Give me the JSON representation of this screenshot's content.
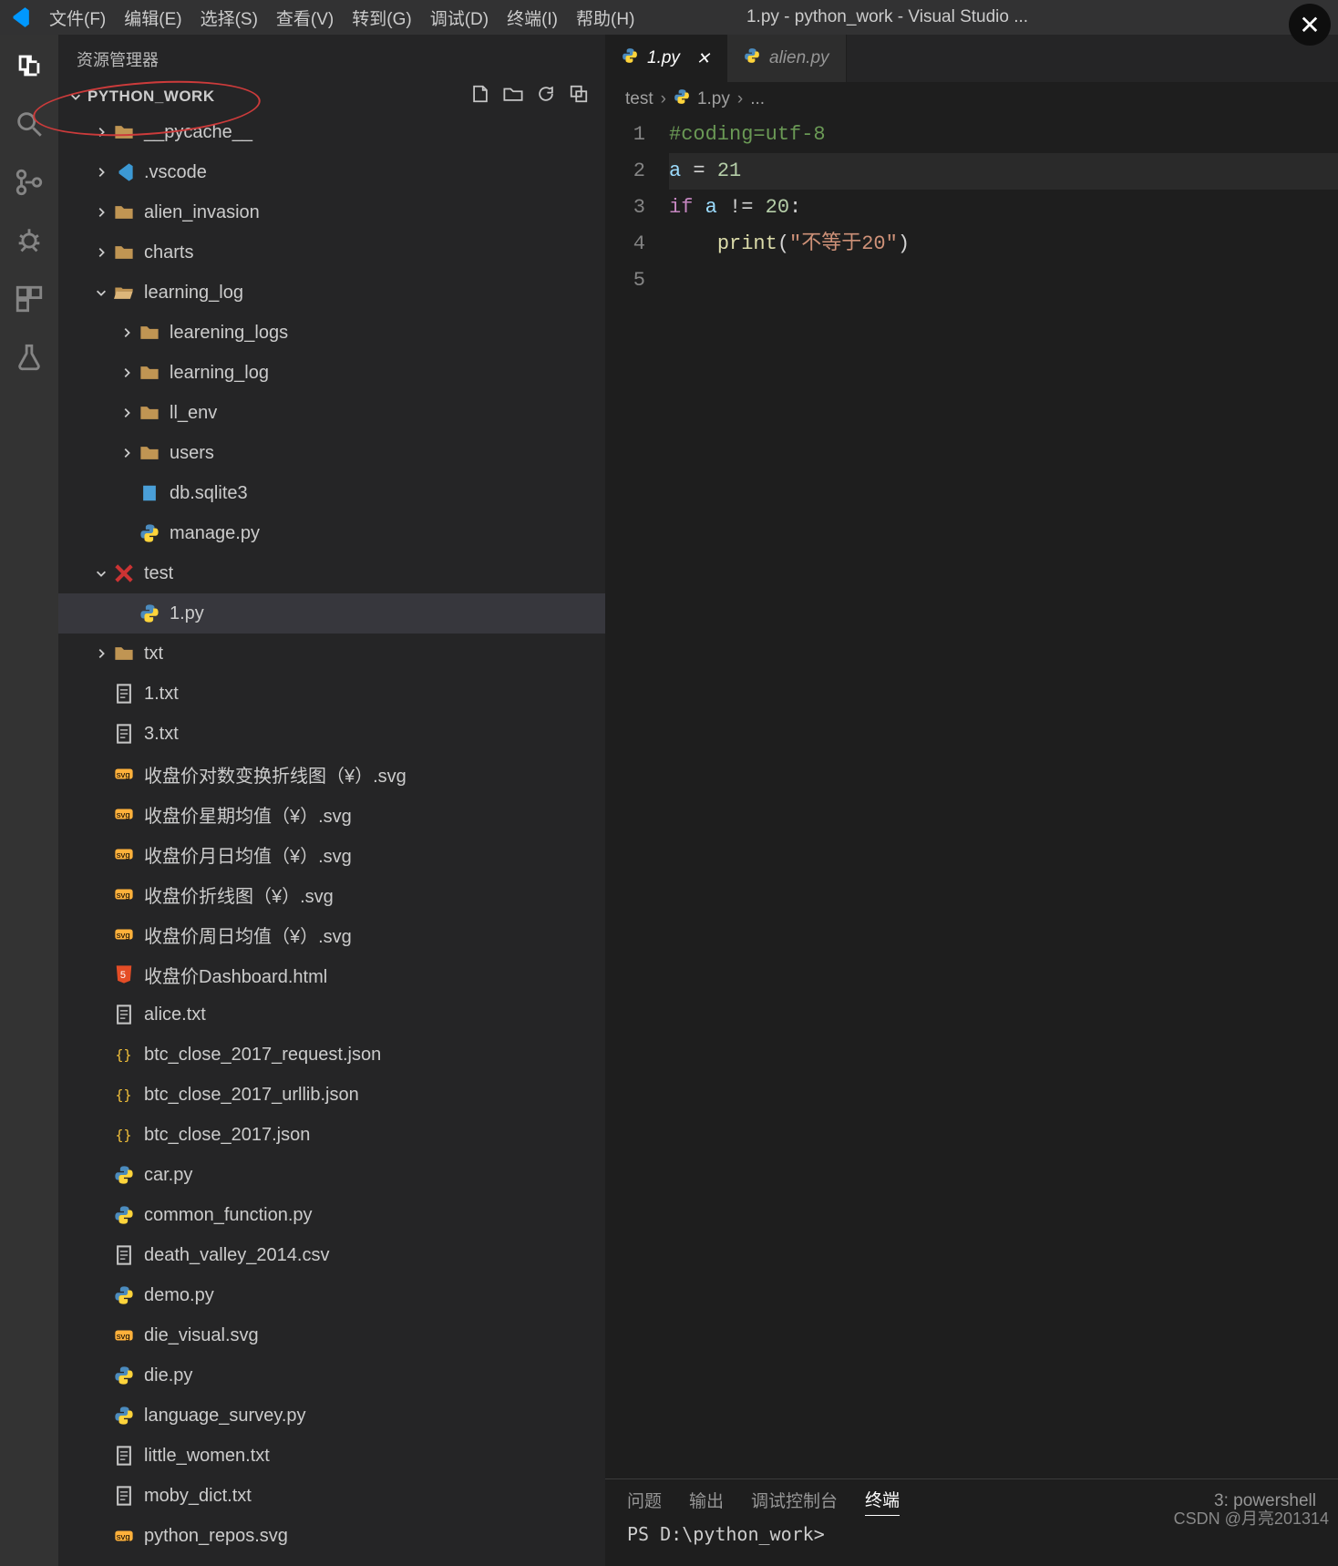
{
  "window_title": "1.py - python_work - Visual Studio ...",
  "menu": [
    "文件(F)",
    "编辑(E)",
    "选择(S)",
    "查看(V)",
    "转到(G)",
    "调试(D)",
    "终端(I)",
    "帮助(H)"
  ],
  "sidebar": {
    "title": "资源管理器",
    "root": "PYTHON_WORK",
    "tree": [
      {
        "depth": 1,
        "chev": "right",
        "icon": "folder",
        "label": "__pycache__"
      },
      {
        "depth": 1,
        "chev": "right",
        "icon": "vscode",
        "label": ".vscode"
      },
      {
        "depth": 1,
        "chev": "right",
        "icon": "folder",
        "label": "alien_invasion"
      },
      {
        "depth": 1,
        "chev": "right",
        "icon": "folder",
        "label": "charts"
      },
      {
        "depth": 1,
        "chev": "down",
        "icon": "folder-open",
        "label": "learning_log"
      },
      {
        "depth": 2,
        "chev": "right",
        "icon": "folder",
        "label": "learening_logs"
      },
      {
        "depth": 2,
        "chev": "right",
        "icon": "folder",
        "label": "learning_log"
      },
      {
        "depth": 2,
        "chev": "right",
        "icon": "folder",
        "label": "ll_env"
      },
      {
        "depth": 2,
        "chev": "right",
        "icon": "folder",
        "label": "users"
      },
      {
        "depth": 2,
        "chev": "none",
        "icon": "db",
        "label": "db.sqlite3"
      },
      {
        "depth": 2,
        "chev": "none",
        "icon": "python",
        "label": "manage.py"
      },
      {
        "depth": 1,
        "chev": "down",
        "icon": "test",
        "label": "test"
      },
      {
        "depth": 2,
        "chev": "none",
        "icon": "python",
        "label": "1.py",
        "selected": true
      },
      {
        "depth": 1,
        "chev": "right",
        "icon": "folder",
        "label": "txt"
      },
      {
        "depth": 1,
        "chev": "none",
        "icon": "text",
        "label": "1.txt"
      },
      {
        "depth": 1,
        "chev": "none",
        "icon": "text",
        "label": "3.txt"
      },
      {
        "depth": 1,
        "chev": "none",
        "icon": "svg",
        "label": "收盘价对数变换折线图（¥）.svg"
      },
      {
        "depth": 1,
        "chev": "none",
        "icon": "svg",
        "label": "收盘价星期均值（¥）.svg"
      },
      {
        "depth": 1,
        "chev": "none",
        "icon": "svg",
        "label": "收盘价月日均值（¥）.svg"
      },
      {
        "depth": 1,
        "chev": "none",
        "icon": "svg",
        "label": "收盘价折线图（¥）.svg"
      },
      {
        "depth": 1,
        "chev": "none",
        "icon": "svg",
        "label": "收盘价周日均值（¥）.svg"
      },
      {
        "depth": 1,
        "chev": "none",
        "icon": "html",
        "label": "收盘价Dashboard.html"
      },
      {
        "depth": 1,
        "chev": "none",
        "icon": "text",
        "label": "alice.txt"
      },
      {
        "depth": 1,
        "chev": "none",
        "icon": "json",
        "label": "btc_close_2017_request.json"
      },
      {
        "depth": 1,
        "chev": "none",
        "icon": "json",
        "label": "btc_close_2017_urllib.json"
      },
      {
        "depth": 1,
        "chev": "none",
        "icon": "json",
        "label": "btc_close_2017.json"
      },
      {
        "depth": 1,
        "chev": "none",
        "icon": "python",
        "label": "car.py"
      },
      {
        "depth": 1,
        "chev": "none",
        "icon": "python",
        "label": "common_function.py"
      },
      {
        "depth": 1,
        "chev": "none",
        "icon": "text",
        "label": "death_valley_2014.csv"
      },
      {
        "depth": 1,
        "chev": "none",
        "icon": "python",
        "label": "demo.py"
      },
      {
        "depth": 1,
        "chev": "none",
        "icon": "svg",
        "label": "die_visual.svg"
      },
      {
        "depth": 1,
        "chev": "none",
        "icon": "python",
        "label": "die.py"
      },
      {
        "depth": 1,
        "chev": "none",
        "icon": "python",
        "label": "language_survey.py"
      },
      {
        "depth": 1,
        "chev": "none",
        "icon": "text",
        "label": "little_women.txt"
      },
      {
        "depth": 1,
        "chev": "none",
        "icon": "text",
        "label": "moby_dict.txt"
      },
      {
        "depth": 1,
        "chev": "none",
        "icon": "svg",
        "label": "python_repos.svg"
      }
    ]
  },
  "tabs": [
    {
      "label": "1.py",
      "active": true,
      "close": true
    },
    {
      "label": "alien.py",
      "active": false,
      "close": false
    }
  ],
  "breadcrumb": {
    "parts": [
      "test",
      "1.py",
      "..."
    ]
  },
  "code": {
    "lines": [
      {
        "n": "1",
        "tokens": [
          {
            "t": "#coding=utf-8",
            "c": "comment"
          }
        ]
      },
      {
        "n": "2",
        "hl": true,
        "tokens": [
          {
            "t": "a",
            "c": "var"
          },
          {
            "t": " = ",
            "c": "op"
          },
          {
            "t": "21",
            "c": "num"
          }
        ]
      },
      {
        "n": "3",
        "tokens": [
          {
            "t": "if",
            "c": "kw"
          },
          {
            "t": " ",
            "c": "op"
          },
          {
            "t": "a",
            "c": "var"
          },
          {
            "t": " != ",
            "c": "op"
          },
          {
            "t": "20",
            "c": "num"
          },
          {
            "t": ":",
            "c": "punc"
          }
        ]
      },
      {
        "n": "4",
        "tokens": [
          {
            "t": "    ",
            "c": "op"
          },
          {
            "t": "print",
            "c": "fn"
          },
          {
            "t": "(",
            "c": "punc"
          },
          {
            "t": "\"不等于20\"",
            "c": "str"
          },
          {
            "t": ")",
            "c": "punc"
          }
        ]
      },
      {
        "n": "5",
        "tokens": []
      }
    ]
  },
  "panel": {
    "tabs": [
      "问题",
      "输出",
      "调试控制台",
      "终端"
    ],
    "active": 3,
    "right": "3: powershell",
    "prompt": "PS D:\\python_work>"
  },
  "watermark": "CSDN @月亮201314"
}
